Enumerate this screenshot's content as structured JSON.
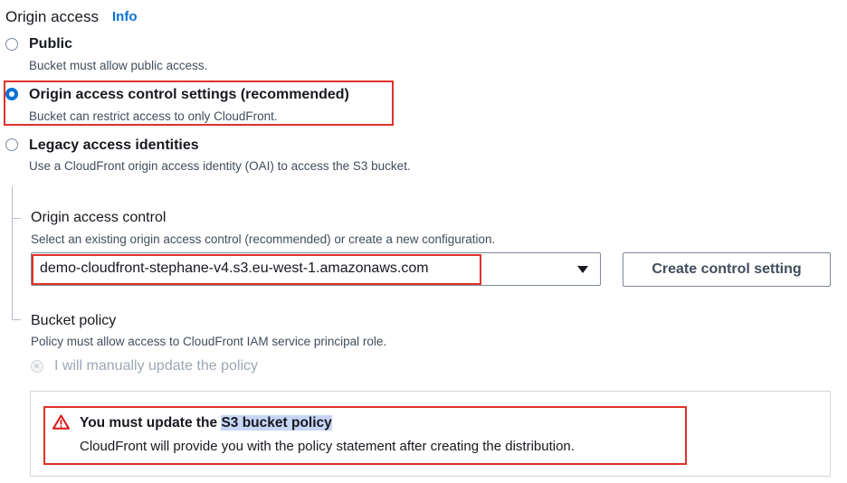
{
  "header": {
    "label": "Origin access",
    "info": "Info"
  },
  "options": [
    {
      "title": "Public",
      "description": "Bucket must allow public access."
    },
    {
      "title": "Origin access control settings (recommended)",
      "description": "Bucket can restrict access to only CloudFront."
    },
    {
      "title": "Legacy access identities",
      "description": "Use a CloudFront origin access identity (OAI) to access the S3 bucket."
    }
  ],
  "selected_option": "Origin access control settings (recommended)",
  "oac": {
    "label": "Origin access control",
    "description": "Select an existing origin access control (recommended) or create a new configuration.",
    "selected_value": "demo-cloudfront-stephane-v4.s3.eu-west-1.amazonaws.com",
    "create_button": "Create control setting"
  },
  "bucket_policy": {
    "label": "Bucket policy",
    "description": "Policy must allow access to CloudFront IAM service principal role.",
    "option": "I will manually update the policy"
  },
  "alert": {
    "title_prefix": "You must update the ",
    "title_link": "S3 bucket policy",
    "description": "CloudFront will provide you with the policy statement after creating the distribution."
  },
  "colors": {
    "accent": "#0972d3",
    "annotation": "#e0312b",
    "warning": "#d91515"
  }
}
